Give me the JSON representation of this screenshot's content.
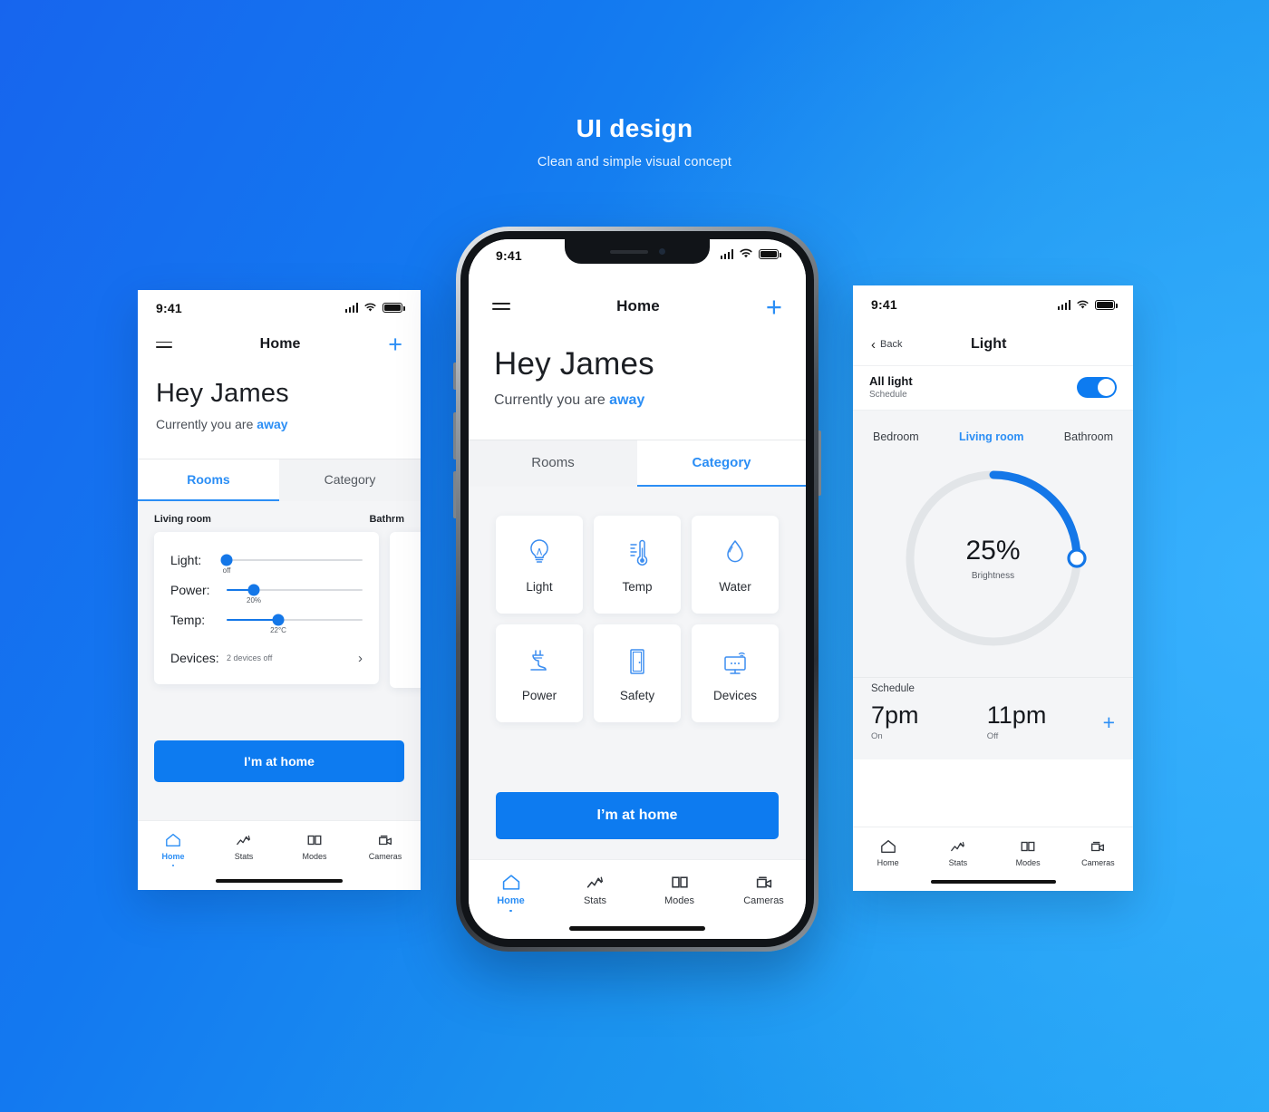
{
  "header": {
    "title": "UI design",
    "subtitle": "Clean and simple visual concept"
  },
  "status_bar": {
    "time": "9:41"
  },
  "left_screen": {
    "appbar": {
      "menu_icon": "hamburger-icon",
      "title": "Home",
      "add_icon": "plus-icon"
    },
    "greeting": {
      "name": "Hey James",
      "status_prefix": "Currently you are ",
      "status_value": "away"
    },
    "tabs": [
      {
        "label": "Rooms",
        "active": true
      },
      {
        "label": "Category",
        "active": false
      }
    ],
    "room_labels": [
      "Living room",
      "Bathrm"
    ],
    "controls": [
      {
        "label": "Light:",
        "value_text": "off",
        "percent": 0
      },
      {
        "label": "Power:",
        "value_text": "20%",
        "percent": 20
      },
      {
        "label": "Temp:",
        "value_text": "22°C",
        "percent": 38
      }
    ],
    "devices_row": {
      "label": "Devices:",
      "value": "2 devices off",
      "chevron": "chevron-right-icon"
    },
    "cta_label": "I’m at home",
    "bottom_nav": [
      {
        "label": "Home",
        "icon": "home-icon",
        "active": true
      },
      {
        "label": "Stats",
        "icon": "chart-line-icon",
        "active": false
      },
      {
        "label": "Modes",
        "icon": "panels-icon",
        "active": false
      },
      {
        "label": "Cameras",
        "icon": "video-camera-icon",
        "active": false
      }
    ]
  },
  "center_phone": {
    "appbar": {
      "menu_icon": "hamburger-icon",
      "title": "Home",
      "add_icon": "plus-icon"
    },
    "greeting": {
      "name": "Hey James",
      "status_prefix": "Currently you are ",
      "status_value": "away"
    },
    "tabs": [
      {
        "label": "Rooms",
        "active": false
      },
      {
        "label": "Category",
        "active": true
      }
    ],
    "categories": [
      {
        "label": "Light",
        "icon": "lightbulb-icon"
      },
      {
        "label": "Temp",
        "icon": "thermometer-icon"
      },
      {
        "label": "Water",
        "icon": "water-drop-icon"
      },
      {
        "label": "Power",
        "icon": "power-plug-icon"
      },
      {
        "label": "Safety",
        "icon": "door-icon"
      },
      {
        "label": "Devices",
        "icon": "monitor-wifi-icon"
      }
    ],
    "cta_label": "I’m at home",
    "bottom_nav": [
      {
        "label": "Home",
        "icon": "home-icon",
        "active": true
      },
      {
        "label": "Stats",
        "icon": "chart-line-icon",
        "active": false
      },
      {
        "label": "Modes",
        "icon": "panels-icon",
        "active": false
      },
      {
        "label": "Cameras",
        "icon": "video-camera-icon",
        "active": false
      }
    ]
  },
  "right_screen": {
    "appbar": {
      "back_label": "Back",
      "back_icon": "chevron-left-icon",
      "title": "Light"
    },
    "all_light": {
      "title": "All light",
      "subtitle": "Schedule",
      "toggle_on": true
    },
    "room_tabs": [
      {
        "label": "Bedroom",
        "active": false
      },
      {
        "label": "Living room",
        "active": true
      },
      {
        "label": "Bathroom",
        "active": false
      }
    ],
    "brightness_dial": {
      "value_label": "25%",
      "caption": "Brightness",
      "percent": 25
    },
    "schedule": {
      "heading": "Schedule",
      "entries": [
        {
          "time": "7pm",
          "state": "On"
        },
        {
          "time": "11pm",
          "state": "Off"
        }
      ],
      "add_icon": "plus-icon"
    },
    "bottom_nav": [
      {
        "label": "Home",
        "icon": "home-icon",
        "active": false
      },
      {
        "label": "Stats",
        "icon": "chart-line-icon",
        "active": false
      },
      {
        "label": "Modes",
        "icon": "panels-icon",
        "active": false
      },
      {
        "label": "Cameras",
        "icon": "video-camera-icon",
        "active": false
      }
    ]
  },
  "colors": {
    "accent": "#2b8ef5",
    "cta": "#0d7bf0",
    "slider": "#1477e8",
    "dial_track": "#e2e5e8",
    "text_dark": "#15181d"
  }
}
